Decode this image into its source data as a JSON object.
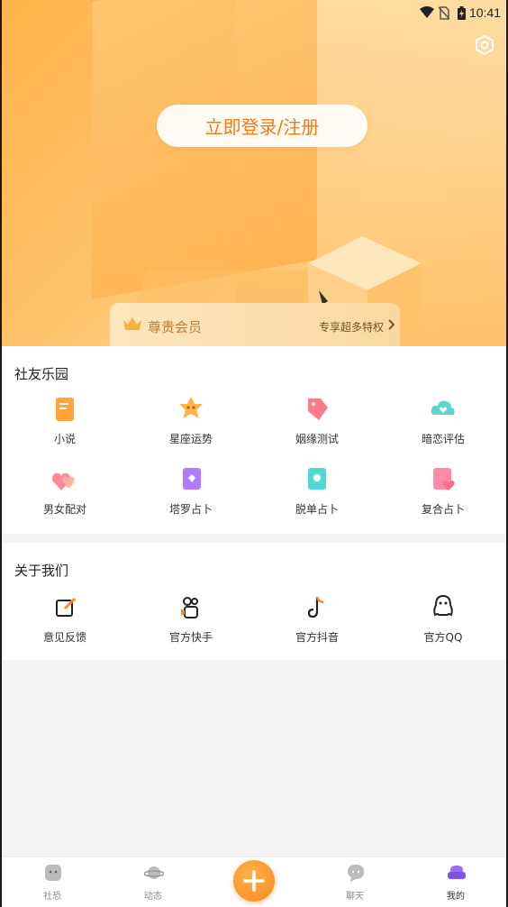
{
  "status_bar": {
    "time": "10:41"
  },
  "hero": {
    "login_label": "立即登录/注册",
    "vip": {
      "title": "尊贵会员",
      "link": "专享超多特权"
    }
  },
  "fun_section": {
    "title": "社友乐园",
    "items": [
      {
        "label": "小说",
        "icon": "book-icon"
      },
      {
        "label": "星座运势",
        "icon": "star-sign-icon"
      },
      {
        "label": "姻缘测试",
        "icon": "tag-heart-icon"
      },
      {
        "label": "暗恋评估",
        "icon": "cloud-heart-icon"
      },
      {
        "label": "男女配对",
        "icon": "double-heart-icon"
      },
      {
        "label": "塔罗占卜",
        "icon": "tarot-card-icon"
      },
      {
        "label": "脱单占卜",
        "icon": "single-card-icon"
      },
      {
        "label": "复合占卜",
        "icon": "reunion-card-icon"
      }
    ]
  },
  "about_section": {
    "title": "关于我们",
    "items": [
      {
        "label": "意见反馈",
        "icon": "feedback-edit-icon"
      },
      {
        "label": "官方快手",
        "icon": "kuaishou-icon"
      },
      {
        "label": "官方抖音",
        "icon": "douyin-icon"
      },
      {
        "label": "官方QQ",
        "icon": "qq-penguin-icon"
      }
    ]
  },
  "bottom_nav": {
    "items": [
      {
        "label": "社恐",
        "icon": "social-face-icon",
        "active": false
      },
      {
        "label": "动态",
        "icon": "planet-icon",
        "active": false
      },
      {
        "label": "聊天",
        "icon": "chat-bubble-icon",
        "active": false
      },
      {
        "label": "我的",
        "icon": "sofa-profile-icon",
        "active": true
      }
    ],
    "fab_icon": "plus-icon"
  },
  "colors": {
    "accent": "#f88a1f",
    "login_text": "#f07a16",
    "vip_text": "#b9803d"
  }
}
